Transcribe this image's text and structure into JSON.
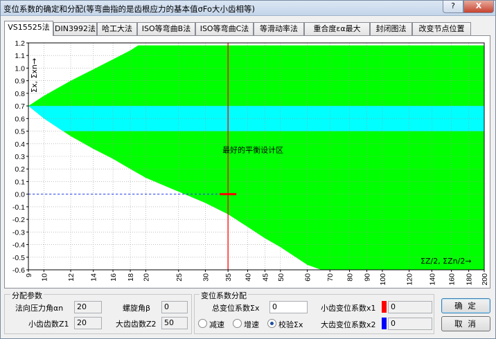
{
  "window": {
    "title": "变位系数的确定和分配(等弯曲指的是齿根应力的基本值σFo大小齿相等)",
    "help_label": "?",
    "close_label": "X"
  },
  "tabs": [
    {
      "label": "VS15525法",
      "active": true
    },
    {
      "label": "DIN3992法",
      "active": false
    },
    {
      "label": "哈工大法",
      "active": false
    },
    {
      "label": "ISO等弯曲B法",
      "active": false
    },
    {
      "label": "ISO等弯曲C法",
      "active": false
    },
    {
      "label": "等滑动率法",
      "active": false
    },
    {
      "label": "重合度εα最大",
      "active": false
    },
    {
      "label": "封闭图法",
      "active": false
    },
    {
      "label": "改变节点位置",
      "active": false
    }
  ],
  "chart_data": {
    "type": "area",
    "y_label": "Σx, Σxn→",
    "x_label": "ΣZ/2, ΣZn/2→",
    "annotation": "最好的平衡设计区",
    "x_scale": "log",
    "xlim": [
      9,
      200
    ],
    "ylim": [
      -0.6,
      1.2
    ],
    "y_ticks": [
      "1.2",
      "1.1",
      "1.0",
      "0.9",
      "0.8",
      "0.7",
      "0.6",
      "0.5",
      "0.4",
      "0.3",
      "0.2",
      "0.1",
      "0.0",
      "-0.1",
      "-0.2",
      "-0.3",
      "-0.4",
      "-0.5",
      "-0.6"
    ],
    "x_ticks": [
      "9",
      "10",
      "12",
      "14",
      "16",
      "18",
      "20",
      "25",
      "30",
      "35",
      "40",
      "45",
      "50",
      "60",
      "70",
      "80",
      "90",
      "100",
      "120",
      "140",
      "160",
      "180",
      "200"
    ],
    "grid": true,
    "colors": {
      "allowed_region": "#00ff00",
      "balanced_band": "#00ffff",
      "marker": "#ff0000",
      "zero_line": "#1a3cff"
    },
    "balanced_band": {
      "y_min": 0.5,
      "y_max": 0.7
    },
    "region_upper_boundary": [
      {
        "x": 9,
        "y": 0.7
      },
      {
        "x": 10,
        "y": 0.78
      },
      {
        "x": 12,
        "y": 0.9
      },
      {
        "x": 14,
        "y": 0.99
      },
      {
        "x": 16,
        "y": 1.07
      },
      {
        "x": 18,
        "y": 1.14
      },
      {
        "x": 19,
        "y": 1.18
      },
      {
        "x": 200,
        "y": 1.18
      }
    ],
    "region_lower_boundary": [
      {
        "x": 9,
        "y": 0.7
      },
      {
        "x": 10,
        "y": 0.6
      },
      {
        "x": 12,
        "y": 0.46
      },
      {
        "x": 14,
        "y": 0.36
      },
      {
        "x": 16,
        "y": 0.28
      },
      {
        "x": 18,
        "y": 0.2
      },
      {
        "x": 20,
        "y": 0.13
      },
      {
        "x": 25,
        "y": 0.02
      },
      {
        "x": 30,
        "y": -0.07
      },
      {
        "x": 35,
        "y": -0.16
      },
      {
        "x": 40,
        "y": -0.26
      },
      {
        "x": 45,
        "y": -0.35
      },
      {
        "x": 50,
        "y": -0.42
      },
      {
        "x": 60,
        "y": -0.56
      },
      {
        "x": 66,
        "y": -0.6
      }
    ],
    "selected_x": 35,
    "selected_y": 0.0
  },
  "params": {
    "group_title": "分配参数",
    "pressure_angle_label": "法向压力角αn",
    "pressure_angle_value": "20",
    "helix_angle_label": "螺旋角β",
    "helix_angle_value": "0",
    "z1_label": "小齿齿数Z1",
    "z1_value": "20",
    "z2_label": "大齿齿数Z2",
    "z2_value": "50"
  },
  "distribution": {
    "group_title": "变位系数分配",
    "total_label": "总变位系数Σx",
    "total_value": "0",
    "x1_label": "小齿变位系数x1",
    "x1_value": "0",
    "x1_color": "#ff0000",
    "x2_label": "大齿变位系数x2",
    "x2_value": "0",
    "x2_color": "#0000ff",
    "radio_options": [
      {
        "label": "减速",
        "checked": false
      },
      {
        "label": "增速",
        "checked": false
      },
      {
        "label": "校验Σx",
        "checked": true
      }
    ]
  },
  "buttons": {
    "ok": "确 定",
    "cancel": "取 消"
  }
}
